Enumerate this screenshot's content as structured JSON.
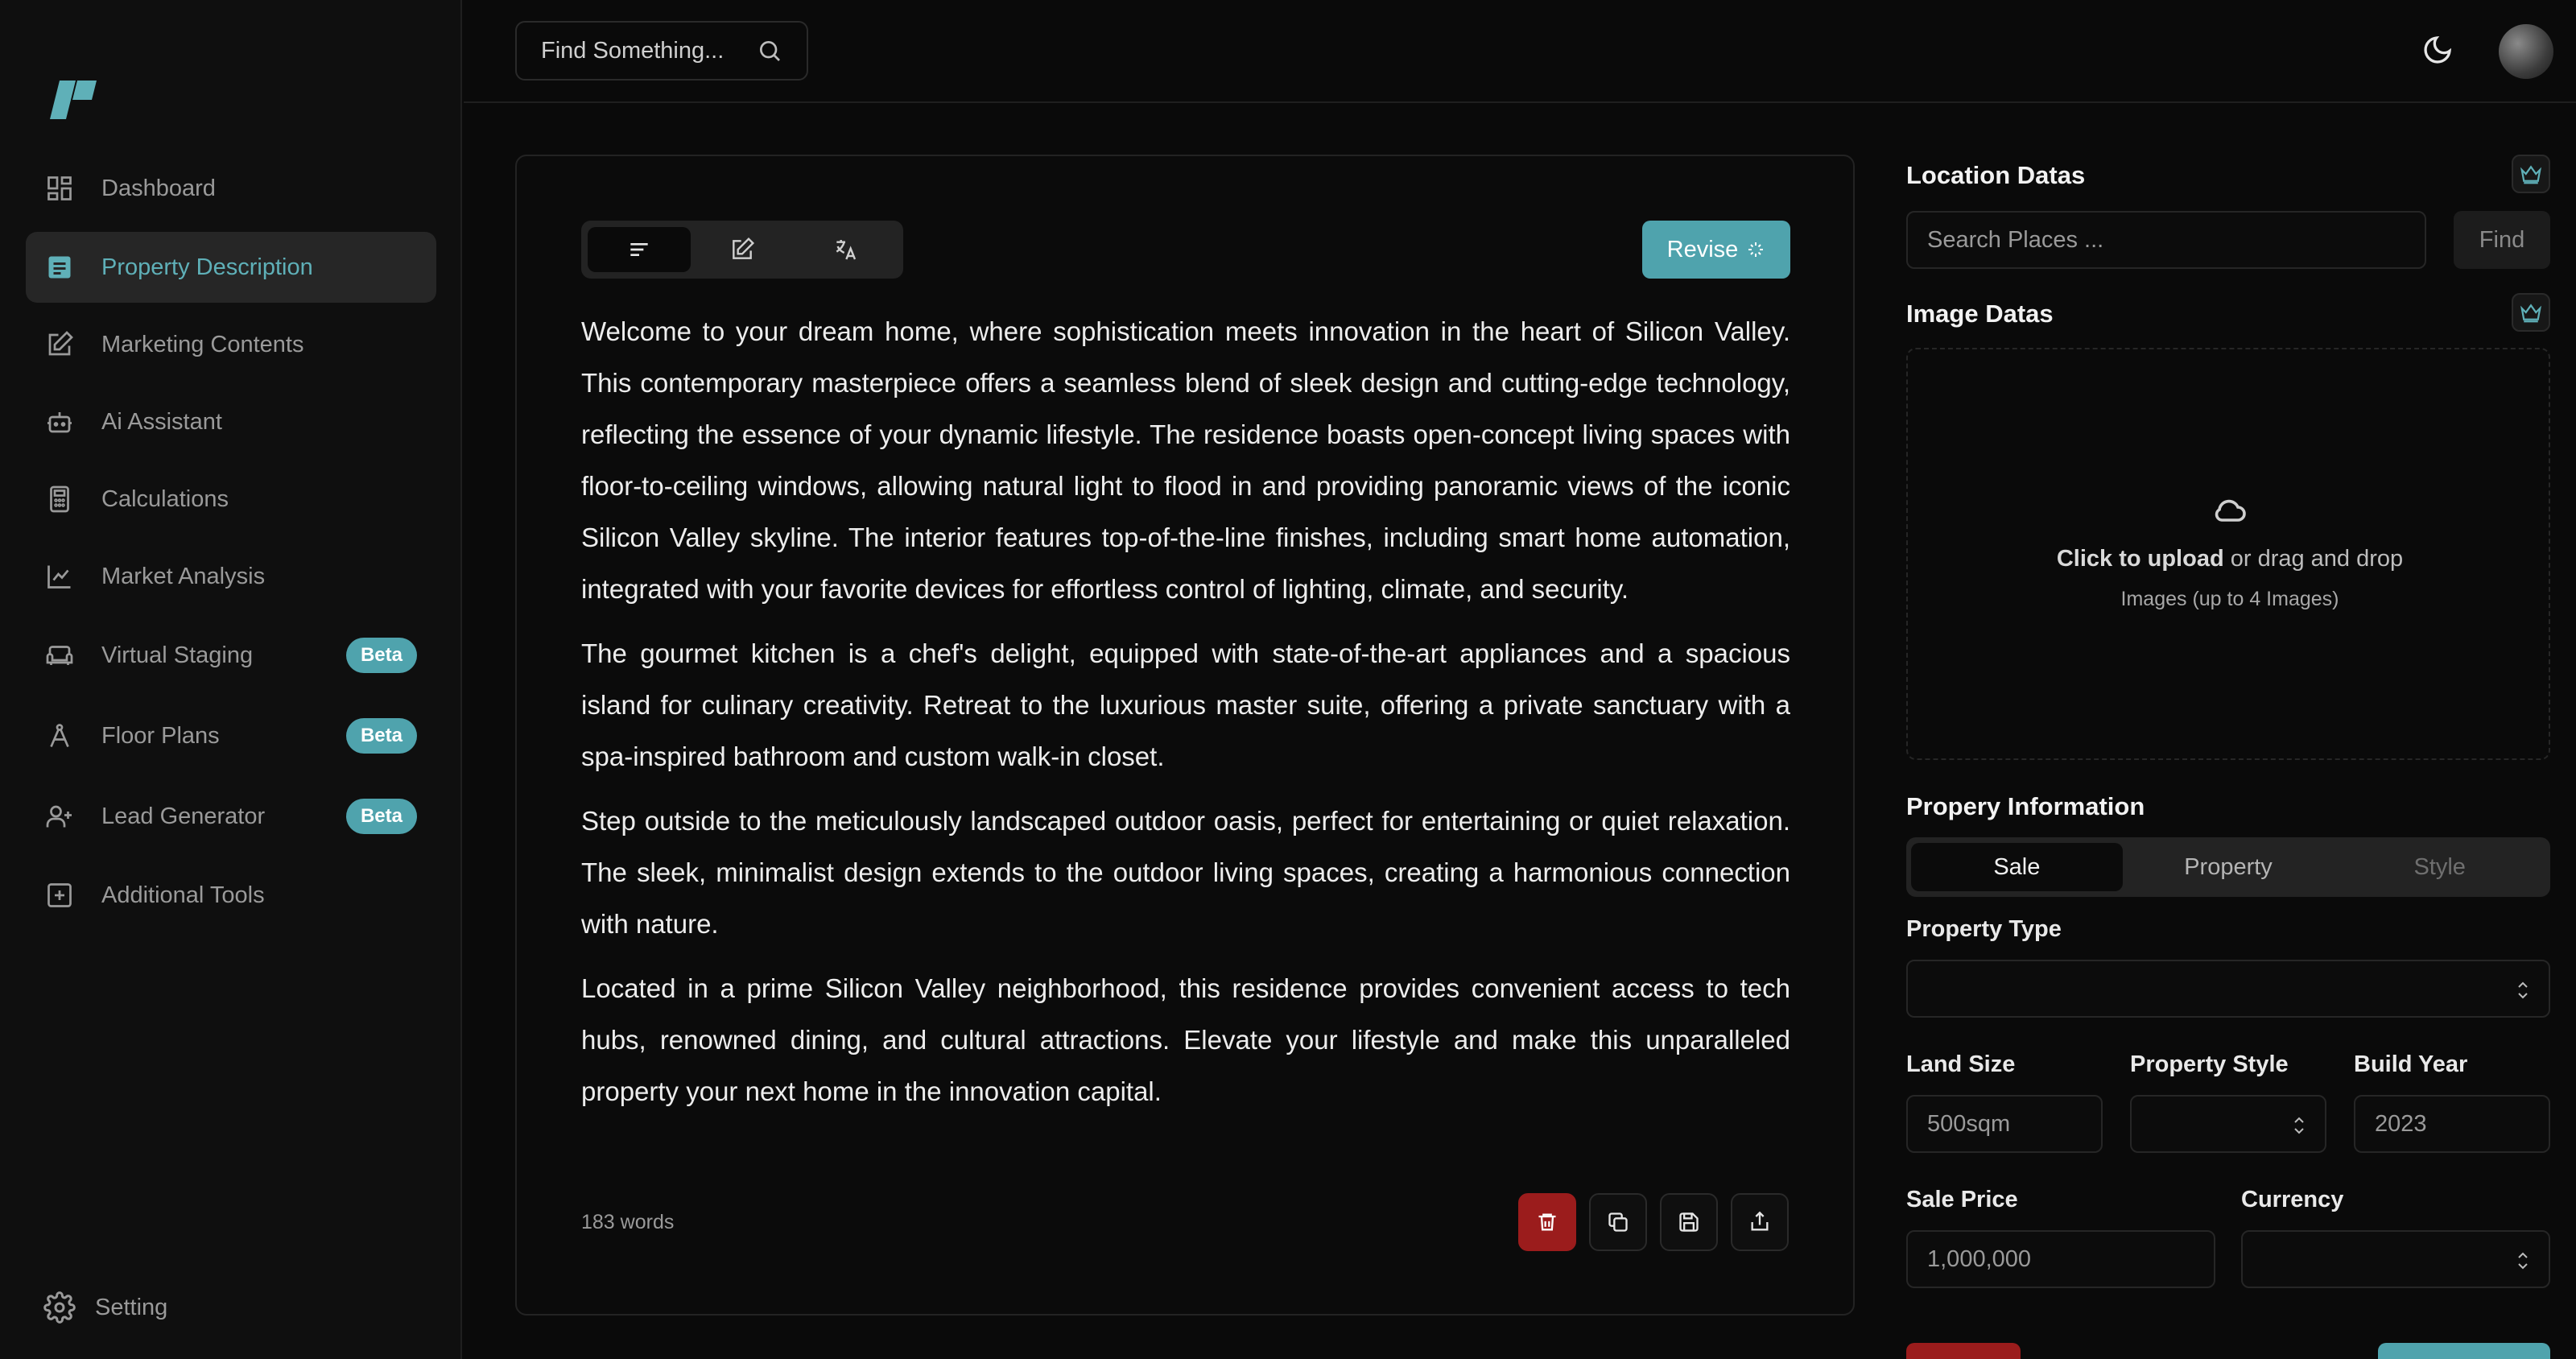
{
  "sidebar": {
    "items": [
      {
        "label": "Dashboard",
        "icon": "dashboard-icon"
      },
      {
        "label": "Property Description",
        "icon": "document-icon",
        "active": true
      },
      {
        "label": "Marketing Contents",
        "icon": "edit-icon"
      },
      {
        "label": "Ai Assistant",
        "icon": "robot-icon"
      },
      {
        "label": "Calculations",
        "icon": "calculator-icon"
      },
      {
        "label": "Market Analysis",
        "icon": "chart-icon"
      },
      {
        "label": "Virtual Staging",
        "icon": "sofa-icon",
        "badge": "Beta"
      },
      {
        "label": "Floor Plans",
        "icon": "compass-icon",
        "badge": "Beta"
      },
      {
        "label": "Lead Generator",
        "icon": "user-plus-icon",
        "badge": "Beta"
      },
      {
        "label": "Additional Tools",
        "icon": "plus-square-icon"
      }
    ],
    "setting_label": "Setting"
  },
  "header": {
    "search_placeholder": "Find Something..."
  },
  "editor": {
    "revise_label": "Revise",
    "paragraphs": [
      "Welcome to your dream home, where sophistication meets innovation in the heart of Silicon Valley. This contemporary masterpiece offers a seamless blend of sleek design and cutting-edge technology, reflecting the essence of your dynamic lifestyle. The residence boasts open-concept living spaces with floor-to-ceiling windows, allowing natural light to flood in and providing panoramic views of the iconic Silicon Valley skyline. The interior features top-of-the-line finishes, including smart home automation, integrated with your favorite devices for effortless control of lighting, climate, and security.",
      "The gourmet kitchen is a chef's delight, equipped with state-of-the-art appliances and a spacious island for culinary creativity. Retreat to the luxurious master suite, offering a private sanctuary with a spa-inspired bathroom and custom walk-in closet.",
      "Step outside to the meticulously landscaped outdoor oasis, perfect for entertaining or quiet relaxation. The sleek, minimalist design extends to the outdoor living spaces, creating a harmonious connection with nature.",
      "Located in a prime Silicon Valley neighborhood, this residence provides convenient access to tech hubs, renowned dining, and cultural attractions. Elevate your lifestyle and make this unparalleled property your next home in the innovation capital."
    ],
    "word_count": "183 words"
  },
  "right_panel": {
    "location_title": "Location Datas",
    "search_places_placeholder": "Search Places ...",
    "find_label": "Find",
    "image_title": "Image Datas",
    "upload_bold": "Click to upload",
    "upload_rest": " or drag and drop",
    "upload_hint": "Images (up to 4 Images)",
    "property_title": "Propery Information",
    "segments": [
      "Sale",
      "Property",
      "Style"
    ],
    "property_type_label": "Property Type",
    "property_type_value": "",
    "land_size_label": "Land Size",
    "land_size_value": "500sqm",
    "property_style_label": "Property Style",
    "property_style_value": "",
    "build_year_label": "Build Year",
    "build_year_value": "2023",
    "sale_price_label": "Sale Price",
    "sale_price_value": "1,000,000",
    "currency_label": "Currency",
    "currency_value": ""
  },
  "colors": {
    "accent": "#4fa3ad",
    "danger": "#9b1c1c",
    "background": "#0a0a0a"
  }
}
